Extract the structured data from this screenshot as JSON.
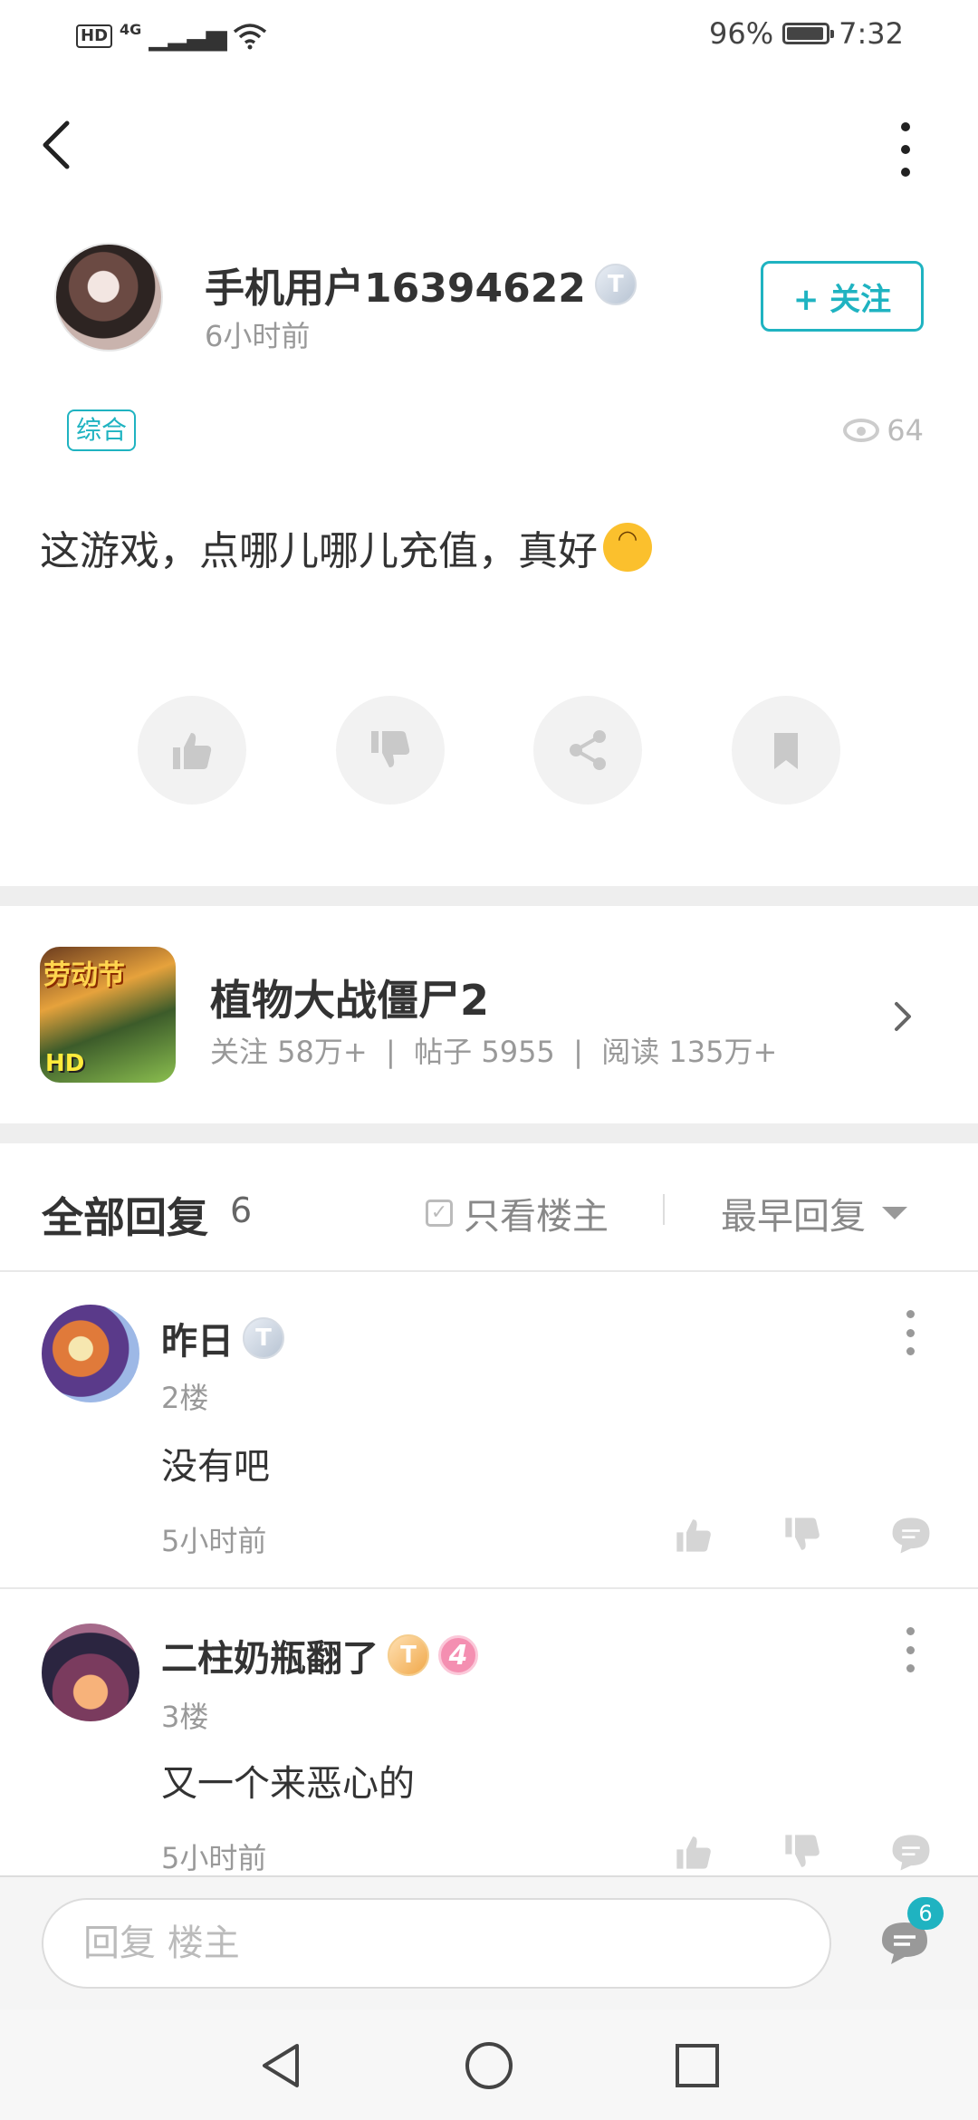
{
  "status_bar": {
    "network_hd": "HD",
    "network_type": "4G",
    "battery_percent": "96%",
    "time": "7:32"
  },
  "post": {
    "author": {
      "name": "手机用户16394622",
      "level_badge": "T",
      "time_ago": "6小时前"
    },
    "follow_label": "+ 关注",
    "tag": "综合",
    "view_count": "64",
    "content": "这游戏，点哪儿哪儿充值，真好",
    "actions": [
      {
        "icon": "thumbs-up-icon"
      },
      {
        "icon": "thumbs-down-icon"
      },
      {
        "icon": "share-icon"
      },
      {
        "icon": "bookmark-icon"
      }
    ]
  },
  "game": {
    "icon_text_top": "劳动节",
    "icon_text_bottom": "HD",
    "title": "植物大战僵尸2",
    "stats": "关注 58万+  |  帖子 5955  |  阅读 135万+"
  },
  "replies_header": {
    "title": "全部回复",
    "count": "6",
    "only_owner_label": "只看楼主",
    "sort_label": "最早回复"
  },
  "replies": [
    {
      "name": "昨日",
      "level_badge": "T",
      "floor": "2楼",
      "content": "没有吧",
      "time_ago": "5小时前"
    },
    {
      "name": "二柱奶瓶翻了",
      "level_badge": "T",
      "vip_badge": "4",
      "floor": "3楼",
      "content": "又一个来恶心的",
      "time_ago": "5小时前"
    }
  ],
  "bottom": {
    "reply_placeholder": "回复  楼主",
    "comment_badge": "6"
  },
  "colors": {
    "accent": "#1fb3c1",
    "divider": "#eeeeee",
    "vip_pink": "#f48fb1"
  }
}
